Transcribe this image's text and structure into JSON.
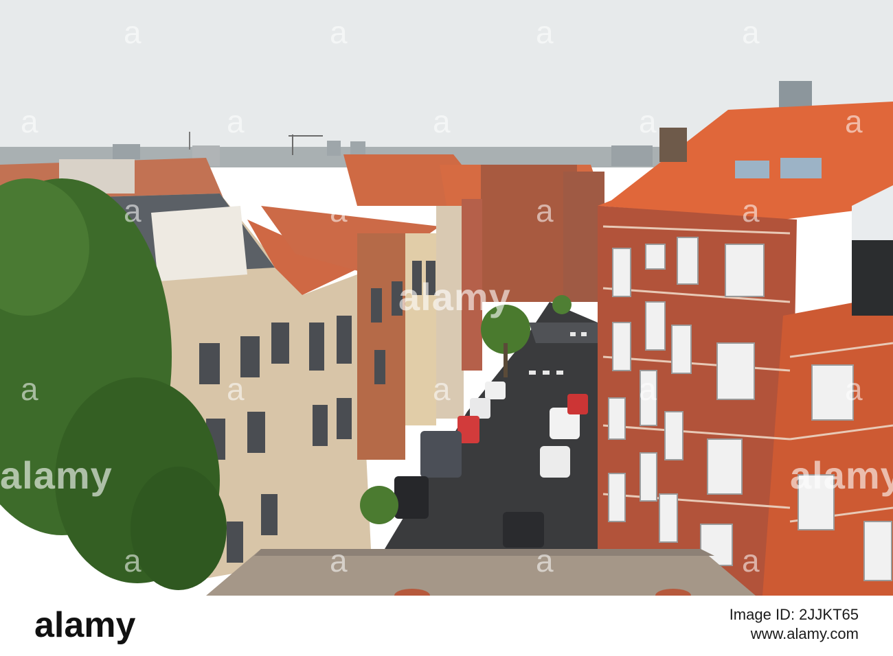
{
  "watermark": {
    "brand": "alamy",
    "repeats": [
      "a",
      "a",
      "a",
      "a",
      "a",
      "a",
      "a",
      "a",
      "a",
      "a",
      "a",
      "a",
      "a",
      "a",
      "a",
      "a",
      "a",
      "a",
      "a",
      "a",
      "a",
      "a",
      "a",
      "a"
    ]
  },
  "footer": {
    "logo_text": "alamy",
    "image_id": "Image ID: 2JJKT65",
    "url": "www.alamy.com"
  },
  "colors": {
    "sky": "#e6e9ea",
    "roof_orange": "#e0673a",
    "brick_red": "#b8553a",
    "stone_beige": "#d8c4a8",
    "tree_green": "#3d6b2a",
    "asphalt": "#3a3b3d"
  }
}
